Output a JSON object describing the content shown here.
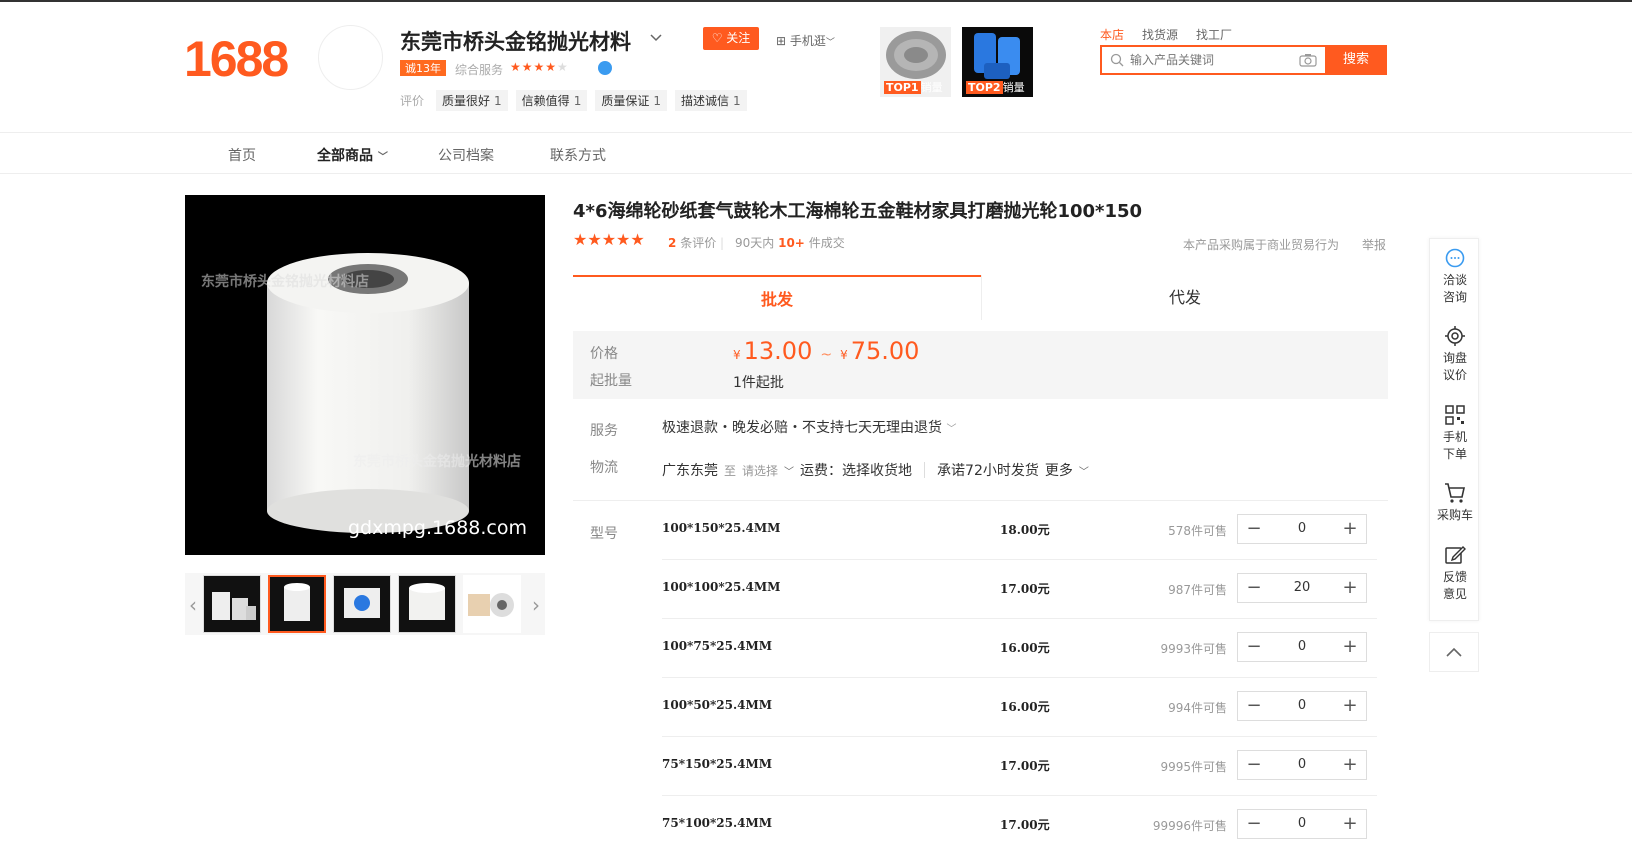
{
  "header": {
    "logo": "1688",
    "shop_name": "东莞市桥头金铭抛光材料",
    "years_badge": "诚13年",
    "service_label": "综合服务",
    "service_stars": "★★★★",
    "service_stars_dim": "★",
    "rating_label": "评价",
    "rating_tags": [
      {
        "label": "质量很好",
        "count": "1"
      },
      {
        "label": "信赖值得",
        "count": "1"
      },
      {
        "label": "质量保证",
        "count": "1"
      },
      {
        "label": "描述诚信",
        "count": "1"
      }
    ],
    "follow_label": "关注",
    "mobile_label": "手机逛",
    "top_products": [
      {
        "rank": "TOP1",
        "label": "销量"
      },
      {
        "rank": "TOP2",
        "label": "销量"
      }
    ],
    "search_tabs": [
      "本店",
      "找货源",
      "找工厂"
    ],
    "search_placeholder": "输入产品关键词",
    "search_button": "搜索"
  },
  "nav": {
    "items": [
      "首页",
      "全部商品",
      "公司档案",
      "联系方式"
    ]
  },
  "gallery": {
    "watermark_top": "东莞市桥头金铭抛光材料店",
    "watermark_mid": "东莞市桥头金铭抛光材料店",
    "watermark_url": "gdxmpg.1688.com"
  },
  "product": {
    "title": "4*6海绵轮砂纸套气鼓轮木工海棉轮五金鞋材家具打磨抛光轮100*150",
    "stars": "★★★★★",
    "review_count": "2",
    "review_suffix": "条评价",
    "sold_prefix": "90天内",
    "sold_count": "10+",
    "sold_suffix": "件成交",
    "trade_note": "本产品采购属于商业贸易行为",
    "report": "举报",
    "tabs": [
      "批发",
      "代发"
    ],
    "price_label": "价格",
    "currency": "¥",
    "price_min": "13.00",
    "price_sep": "~",
    "price_max": "75.00",
    "moq_label": "起批量",
    "moq": "1件起批",
    "service_label": "服务",
    "service_text": "极速退款・晚发必赔・不支持七天无理由退货",
    "logistics_label": "物流",
    "origin": "广东东莞",
    "to_word": "至",
    "choose": "请选择",
    "freight": "运费：选择收货地",
    "promise": "承诺72小时发货",
    "more": "更多",
    "model_label": "型号"
  },
  "skus": [
    {
      "name": "100*150*25.4MM",
      "price": "18.00元",
      "stock": "578件可售",
      "qty": "0"
    },
    {
      "name": "100*100*25.4MM",
      "price": "17.00元",
      "stock": "987件可售",
      "qty": "20"
    },
    {
      "name": "100*75*25.4MM",
      "price": "16.00元",
      "stock": "9993件可售",
      "qty": "0"
    },
    {
      "name": "100*50*25.4MM",
      "price": "16.00元",
      "stock": "994件可售",
      "qty": "0"
    },
    {
      "name": "75*150*25.4MM",
      "price": "17.00元",
      "stock": "9995件可售",
      "qty": "0"
    },
    {
      "name": "75*100*25.4MM",
      "price": "17.00元",
      "stock": "99996件可售",
      "qty": "0"
    }
  ],
  "sidebar": {
    "items": [
      {
        "line1": "洽谈",
        "line2": "咨询",
        "icon": "chat-icon"
      },
      {
        "line1": "询盘",
        "line2": "议价",
        "icon": "target-icon"
      },
      {
        "line1": "手机",
        "line2": "下单",
        "icon": "qr-icon"
      },
      {
        "line1": "采购车",
        "line2": "",
        "icon": "cart-icon"
      },
      {
        "line1": "反馈",
        "line2": "意见",
        "icon": "edit-icon"
      }
    ]
  },
  "colors": {
    "accent": "#ff5a1f",
    "blue": "#3a9bf0"
  }
}
